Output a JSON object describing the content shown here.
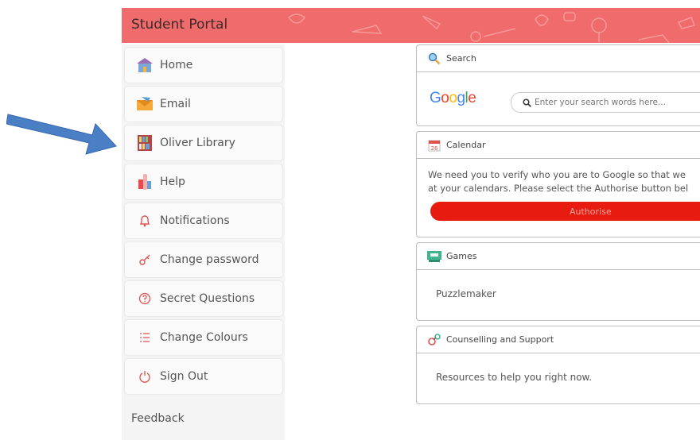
{
  "header": {
    "title": "Student Portal",
    "bg_color": "#f06b6b"
  },
  "sidebar": {
    "items": [
      {
        "label": "Home",
        "icon": "home-icon"
      },
      {
        "label": "Email",
        "icon": "email-icon"
      },
      {
        "label": "Oliver Library",
        "icon": "library-icon"
      },
      {
        "label": "Help",
        "icon": "help-icon"
      },
      {
        "label": "Notifications",
        "icon": "bell-icon"
      },
      {
        "label": "Change password",
        "icon": "key-icon"
      },
      {
        "label": "Secret Questions",
        "icon": "question-circle-icon"
      },
      {
        "label": "Change Colours",
        "icon": "list-icon"
      },
      {
        "label": "Sign Out",
        "icon": "power-icon"
      }
    ],
    "feedback": "Feedback"
  },
  "cards": {
    "search": {
      "title": "Search",
      "brand": "Google",
      "placeholder": "Enter your search words here..."
    },
    "calendar": {
      "title": "Calendar",
      "icon_day": "26",
      "line1": "We need you to verify who you are to Google so that we",
      "line2": "at your calendars. Please select the Authorise button bel",
      "button": "Authorise",
      "button_color": "#e81b10"
    },
    "games": {
      "title": "Games",
      "link": "Puzzlemaker"
    },
    "counselling": {
      "title": "Counselling and Support",
      "link": "Resources to help you right now."
    }
  },
  "annotation": {
    "arrow_color": "#4a7fc6"
  }
}
